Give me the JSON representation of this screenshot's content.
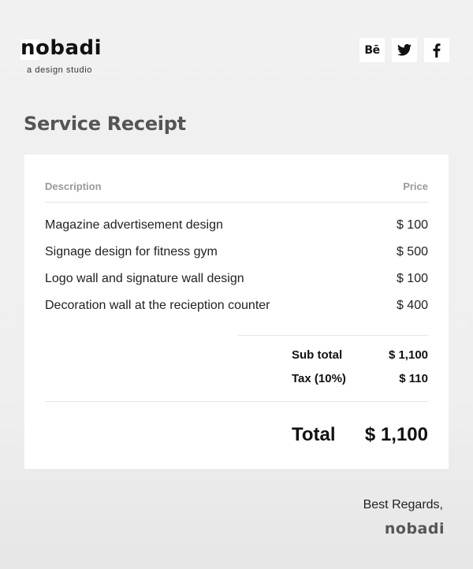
{
  "brand": {
    "name": "nobadi",
    "tagline": "a design studio"
  },
  "social": [
    {
      "icon": "behance-icon",
      "label": "Bē"
    },
    {
      "icon": "twitter-icon"
    },
    {
      "icon": "facebook-icon"
    }
  ],
  "title": "Service Receipt",
  "table": {
    "columns": [
      "Description",
      "Price"
    ],
    "rows": [
      {
        "description": "Magazine advertisement design",
        "price": "$ 100"
      },
      {
        "description": "Signage design for fitness gym",
        "price": "$ 500"
      },
      {
        "description": "Logo wall and signature wall design",
        "price": "$ 100"
      },
      {
        "description": "Decoration wall at the recieption counter",
        "price": "$ 400"
      }
    ]
  },
  "summary": {
    "subtotal_label": "Sub total",
    "subtotal_value": "$ 1,100",
    "tax_label": "Tax (10%)",
    "tax_value": "$ 110",
    "total_label": "Total",
    "total_value": "$ 1,100"
  },
  "footer": {
    "regards": "Best Regards,",
    "signature": "nobadi"
  },
  "colors": {
    "background": "#efefef",
    "card": "#ffffff",
    "heading": "#555555",
    "muted": "#9a9a9a"
  }
}
